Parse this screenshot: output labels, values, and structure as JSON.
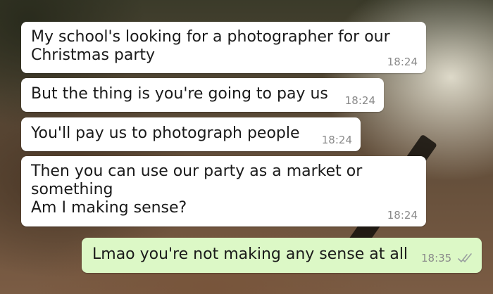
{
  "conversation": {
    "messages": [
      {
        "direction": "incoming",
        "text": "My school's looking for a photographer for our\nChristmas party",
        "time": "18:24"
      },
      {
        "direction": "incoming",
        "text": "But the thing is you're going to pay us",
        "time": "18:24"
      },
      {
        "direction": "incoming",
        "text": "You'll pay us to photograph people",
        "time": "18:24"
      },
      {
        "direction": "incoming",
        "text": "Then you can use our party as a market or\nsomething\nAm I making sense?",
        "time": "18:24"
      },
      {
        "direction": "outgoing",
        "text": "Lmao you're not making any sense at all",
        "time": "18:35",
        "status_icon": "double-check-icon"
      }
    ]
  },
  "colors": {
    "incoming_bubble": "#ffffff",
    "outgoing_bubble": "#dcf8c6",
    "timestamp": "#8a8a8a",
    "read_ticks": "#9aa0a0"
  }
}
